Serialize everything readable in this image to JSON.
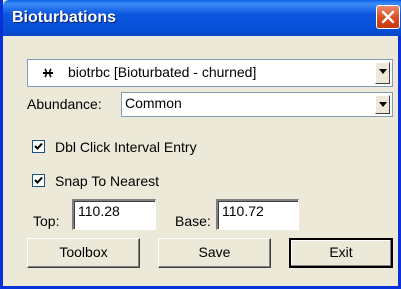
{
  "window": {
    "title": "Bioturbations"
  },
  "bioturbation_select": {
    "value": "biotrbc [Bioturbated - churned]",
    "icon": "bioturbation-symbol-icon"
  },
  "abundance": {
    "label": "Abundance:",
    "value": "Common"
  },
  "options": {
    "dbl_click": {
      "label": "Dbl Click Interval Entry",
      "checked": true
    },
    "snap": {
      "label": "Snap To Nearest",
      "checked": true
    }
  },
  "interval": {
    "top_label": "Top:",
    "top_value": "110.28",
    "base_label": "Base:",
    "base_value": "110.72"
  },
  "buttons": {
    "toolbox": "Toolbox",
    "save": "Save",
    "exit": "Exit"
  },
  "colors": {
    "title_bar": "#0a5fe8",
    "close": "#d8491c",
    "dialog_bg": "#ece9d8"
  }
}
